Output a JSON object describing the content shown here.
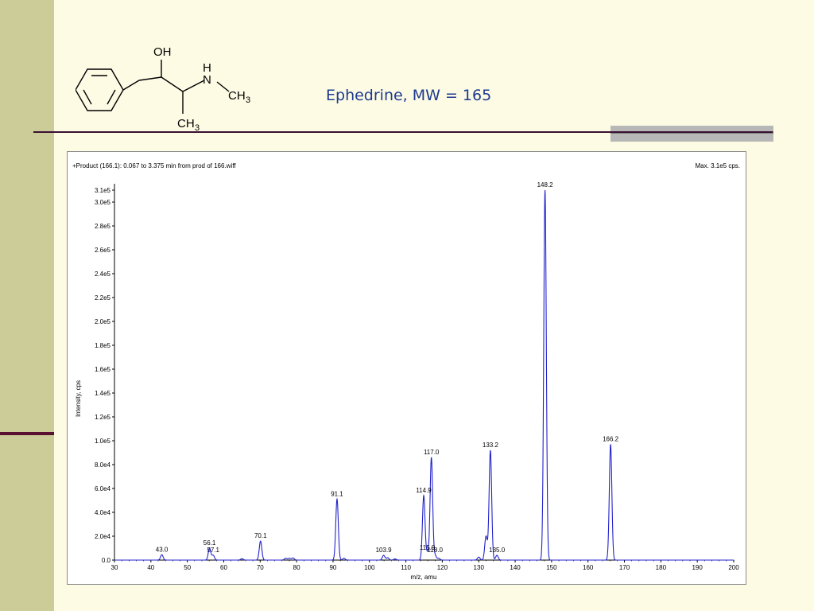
{
  "slide": {
    "title": "Ephedrine, MW = 165"
  },
  "molecule": {
    "labels": {
      "oh": "OH",
      "h": "H",
      "n": "N",
      "ch3_n": "CH",
      "ch3_n_sub": "3",
      "ch3_c": "CH",
      "ch3_c_sub": "3"
    }
  },
  "spectrum": {
    "header_left": "+Product (166.1): 0.067 to 3.375 min from prod of 166.wiff",
    "header_right": "Max. 3.1e5 cps."
  },
  "colors": {
    "trace": "#2222cc",
    "title": "#1d3a8f",
    "sidebar": "#cccc99",
    "background": "#fdfbe4"
  },
  "chart_data": {
    "type": "line",
    "xlabel": "m/z, amu",
    "ylabel": "Intensity, cps",
    "xlim": [
      30,
      200
    ],
    "ylim": [
      0,
      310000
    ],
    "x_ticks": [
      30,
      40,
      50,
      60,
      70,
      80,
      90,
      100,
      110,
      120,
      130,
      140,
      150,
      160,
      170,
      180,
      190,
      200
    ],
    "y_ticks": [
      {
        "v": 0,
        "l": "0.0"
      },
      {
        "v": 20000,
        "l": "2.0e4"
      },
      {
        "v": 40000,
        "l": "4.0e4"
      },
      {
        "v": 60000,
        "l": "6.0e4"
      },
      {
        "v": 80000,
        "l": "8.0e4"
      },
      {
        "v": 100000,
        "l": "1.0e5"
      },
      {
        "v": 120000,
        "l": "1.2e5"
      },
      {
        "v": 140000,
        "l": "1.4e5"
      },
      {
        "v": 160000,
        "l": "1.6e5"
      },
      {
        "v": 180000,
        "l": "1.8e5"
      },
      {
        "v": 200000,
        "l": "2.0e5"
      },
      {
        "v": 220000,
        "l": "2.2e5"
      },
      {
        "v": 240000,
        "l": "2.4e5"
      },
      {
        "v": 260000,
        "l": "2.6e5"
      },
      {
        "v": 280000,
        "l": "2.8e5"
      },
      {
        "v": 300000,
        "l": "3.0e5"
      },
      {
        "v": 310000,
        "l": "3.1e5"
      }
    ],
    "peaks": [
      {
        "mz": 43.0,
        "intensity": 4500,
        "label": "43.0"
      },
      {
        "mz": 56.1,
        "intensity": 10000,
        "label": "56.1"
      },
      {
        "mz": 57.1,
        "intensity": 4000,
        "label": "57.1"
      },
      {
        "mz": 65.0,
        "intensity": 1200,
        "label": ""
      },
      {
        "mz": 70.1,
        "intensity": 16000,
        "label": "70.1"
      },
      {
        "mz": 77.0,
        "intensity": 1500,
        "label": ""
      },
      {
        "mz": 78.0,
        "intensity": 1500,
        "label": ""
      },
      {
        "mz": 79.0,
        "intensity": 1800,
        "label": ""
      },
      {
        "mz": 91.1,
        "intensity": 51000,
        "label": "91.1"
      },
      {
        "mz": 93.0,
        "intensity": 1500,
        "label": ""
      },
      {
        "mz": 103.9,
        "intensity": 4000,
        "label": "103.9"
      },
      {
        "mz": 105.0,
        "intensity": 2000,
        "label": ""
      },
      {
        "mz": 107.0,
        "intensity": 1000,
        "label": ""
      },
      {
        "mz": 114.9,
        "intensity": 54000,
        "label": "114.9"
      },
      {
        "mz": 115.9,
        "intensity": 6000,
        "label": "115.9"
      },
      {
        "mz": 117.0,
        "intensity": 86000,
        "label": "117.0"
      },
      {
        "mz": 118.0,
        "intensity": 4000,
        "label": "118.0"
      },
      {
        "mz": 119.0,
        "intensity": 1500,
        "label": ""
      },
      {
        "mz": 130.0,
        "intensity": 2500,
        "label": ""
      },
      {
        "mz": 132.0,
        "intensity": 20000,
        "label": ""
      },
      {
        "mz": 133.2,
        "intensity": 92000,
        "label": "133.2"
      },
      {
        "mz": 135.0,
        "intensity": 4000,
        "label": "135.0"
      },
      {
        "mz": 148.2,
        "intensity": 310000,
        "label": "148.2"
      },
      {
        "mz": 166.2,
        "intensity": 97000,
        "label": "166.2"
      }
    ]
  }
}
